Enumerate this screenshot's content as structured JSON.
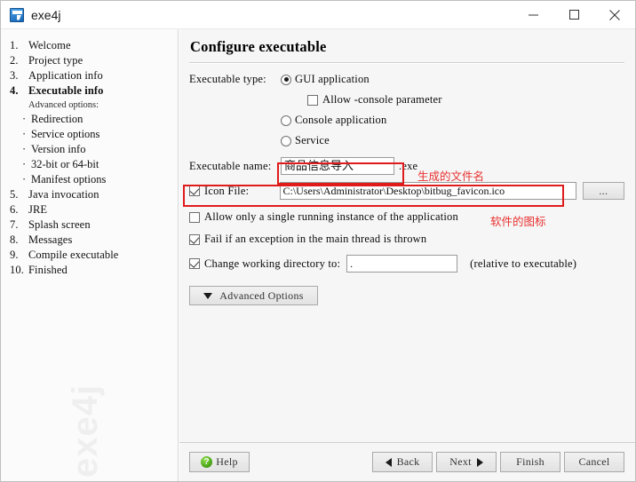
{
  "window": {
    "title": "exe4j",
    "icon": "exe4j-app-icon",
    "controls": {
      "minimize": "minimize-icon",
      "maximize": "maximize-icon",
      "close": "close-icon"
    }
  },
  "sidebar": {
    "watermark": "exe4j",
    "items": [
      {
        "num": "1.",
        "label": "Welcome",
        "current": false
      },
      {
        "num": "2.",
        "label": "Project type",
        "current": false
      },
      {
        "num": "3.",
        "label": "Application info",
        "current": false
      },
      {
        "num": "4.",
        "label": "Executable info",
        "current": true
      },
      {
        "num": "5.",
        "label": "Java invocation",
        "current": false
      },
      {
        "num": "6.",
        "label": "JRE",
        "current": false
      },
      {
        "num": "7.",
        "label": "Splash screen",
        "current": false
      },
      {
        "num": "8.",
        "label": "Messages",
        "current": false
      },
      {
        "num": "9.",
        "label": "Compile executable",
        "current": false
      },
      {
        "num": "10.",
        "label": "Finished",
        "current": false
      }
    ],
    "advanced_label": "Advanced options:",
    "advanced_items": [
      "Redirection",
      "Service options",
      "Version info",
      "32-bit or 64-bit",
      "Manifest options"
    ]
  },
  "main": {
    "title": "Configure executable",
    "exec_type_label": "Executable type:",
    "exec_type_options": [
      {
        "label": "GUI application",
        "selected": true
      },
      {
        "label": "Console application",
        "selected": false
      },
      {
        "label": "Service",
        "selected": false
      }
    ],
    "allow_console": {
      "label": "Allow -console parameter",
      "checked": false
    },
    "exec_name_label": "Executable name:",
    "exec_name_value": "商品信息导入",
    "exec_name_suffix": ".exe",
    "icon_file": {
      "label": "Icon File:",
      "checked": true,
      "value": "C:\\Users\\Administrator\\Desktop\\bitbug_favicon.ico",
      "browse_label": "..."
    },
    "single_instance": {
      "label": "Allow only a single running instance of the application",
      "checked": false
    },
    "fail_exception": {
      "label": "Fail if an exception in the main thread is thrown",
      "checked": true
    },
    "working_dir": {
      "label": "Change working directory to:",
      "checked": true,
      "value": ".",
      "hint": "(relative to executable)"
    },
    "advanced_options_button": "Advanced Options"
  },
  "annotations": {
    "color": "#e8302f",
    "filename_note": "生成的文件名",
    "icon_note": "软件的图标"
  },
  "footer": {
    "help": "Help",
    "back": "Back",
    "next": "Next",
    "finish": "Finish",
    "cancel": "Cancel"
  }
}
